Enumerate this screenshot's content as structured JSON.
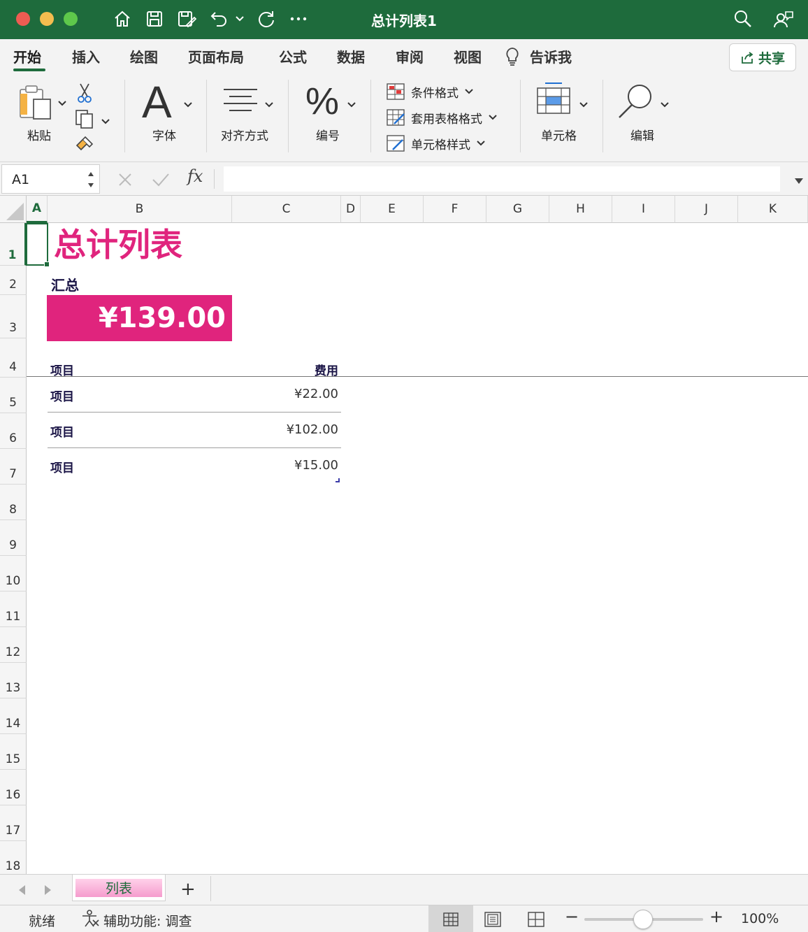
{
  "window": {
    "title": "总计列表1"
  },
  "ribbon_tabs": [
    "开始",
    "插入",
    "绘图",
    "页面布局",
    "公式",
    "数据",
    "审阅",
    "视图",
    "告诉我"
  ],
  "share_label": "共享",
  "ribbon": {
    "paste": "粘贴",
    "font": "字体",
    "alignment": "对齐方式",
    "number": "编号",
    "conditional_format": "条件格式",
    "format_as_table": "套用表格格式",
    "cell_styles": "单元格样式",
    "cells": "单元格",
    "editing": "编辑"
  },
  "formula_bar": {
    "name_box": "A1",
    "fx": "fx",
    "formula": ""
  },
  "columns": [
    "A",
    "B",
    "C",
    "D",
    "E",
    "F",
    "G",
    "H",
    "I",
    "J",
    "K"
  ],
  "rows": [
    "1",
    "2",
    "3",
    "4",
    "5",
    "6",
    "7",
    "8",
    "9",
    "10",
    "11",
    "12",
    "13",
    "14",
    "15",
    "16",
    "17",
    "18"
  ],
  "sheet": {
    "title": "总计列表",
    "summary_label": "汇总",
    "summary_value": "¥139.00",
    "header_item": "项目",
    "header_cost": "费用",
    "items": [
      {
        "name": "项目",
        "cost": "¥22.00"
      },
      {
        "name": "项目",
        "cost": "¥102.00"
      },
      {
        "name": "项目",
        "cost": "¥15.00"
      }
    ]
  },
  "sheet_tabs": [
    "列表"
  ],
  "status": {
    "ready": "就绪",
    "accessibility": "辅助功能: 调查",
    "zoom": "100%"
  },
  "colors": {
    "titlebar": "#1e6b3c",
    "accent_pink": "#e0247d",
    "text_dark": "#1a1446"
  }
}
